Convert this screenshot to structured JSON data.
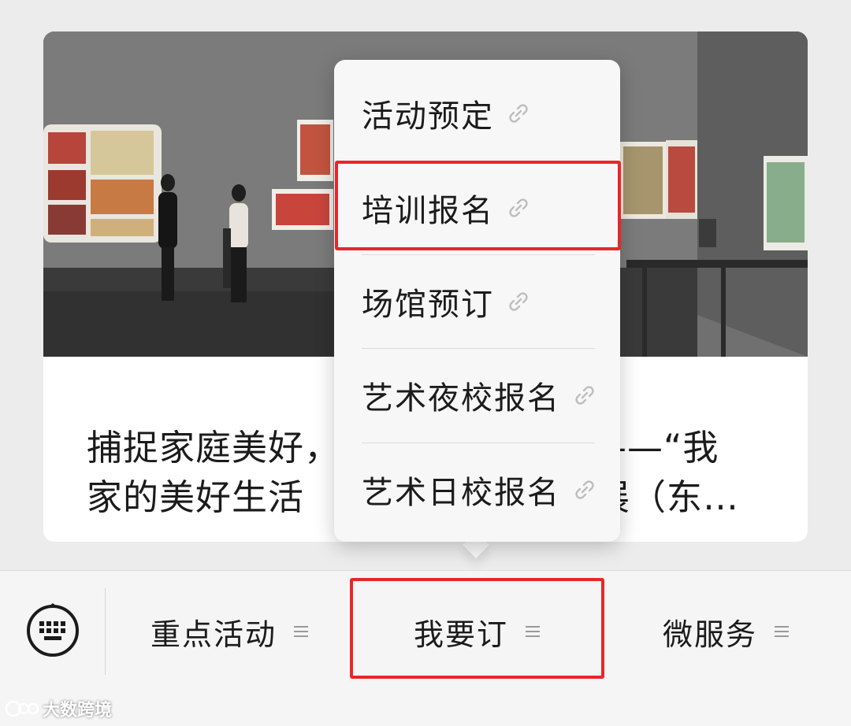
{
  "article": {
    "title_line1": "捕捉家庭美好，",
    "title_line1_right": "——“我",
    "title_line2": "家的美好生活",
    "title_line2_right": "展（东…"
  },
  "popup_menu": {
    "items": [
      {
        "label": "活动预定",
        "icon": "link-icon",
        "highlighted": false
      },
      {
        "label": "培训报名",
        "icon": "link-icon",
        "highlighted": true
      },
      {
        "label": "场馆预订",
        "icon": "link-icon",
        "highlighted": false
      },
      {
        "label": "艺术夜校报名",
        "icon": "link-icon",
        "highlighted": false
      },
      {
        "label": "艺术日校报名",
        "icon": "link-icon",
        "highlighted": false
      }
    ]
  },
  "bottom_menu": {
    "keyboard_icon": "keyboard-icon",
    "items": [
      {
        "label": "重点活动",
        "icon": "menu-lines-icon",
        "highlighted": false
      },
      {
        "label": "我要订",
        "icon": "menu-lines-icon",
        "highlighted": true
      },
      {
        "label": "微服务",
        "icon": "menu-lines-icon",
        "highlighted": false
      }
    ]
  },
  "watermark": {
    "text": "大数跨境"
  },
  "colors": {
    "highlight": "#e8262a",
    "background": "#ececec",
    "popup": "#f7f7f7",
    "bar": "#f5f5f5"
  }
}
